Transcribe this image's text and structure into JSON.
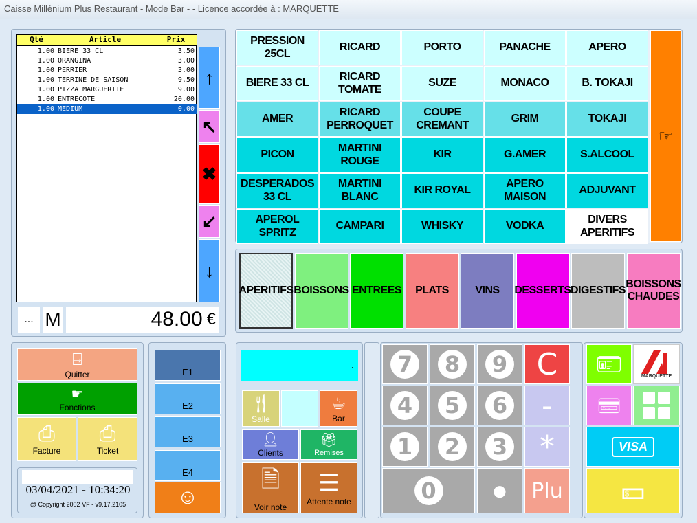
{
  "window": {
    "title": "Caisse Millénium Plus Restaurant - Mode Bar -   - Licence accordée à : MARQUETTE"
  },
  "ticket": {
    "headers": [
      "Qté",
      "Article",
      "Prix"
    ],
    "rows": [
      {
        "qty": "1.00",
        "article": "BIERE 33 CL",
        "price": "3.50"
      },
      {
        "qty": "1.00",
        "article": "ORANGINA",
        "price": "3.00"
      },
      {
        "qty": "1.00",
        "article": "PERRIER",
        "price": "3.00"
      },
      {
        "qty": "1.00",
        "article": "TERRINE DE SAISON",
        "price": "9.50"
      },
      {
        "qty": "1.00",
        "article": "PIZZA MARGUERITE",
        "price": "9.00"
      },
      {
        "qty": "1.00",
        "article": "ENTRECOTE",
        "price": "20.00"
      },
      {
        "qty": "1.00",
        "article": "MEDIUM",
        "price": "0.00"
      }
    ],
    "dots": "...",
    "mode": "M",
    "total": "48.00",
    "currency": "€"
  },
  "products": [
    "PRESSION 25CL",
    "RICARD",
    "PORTO",
    "PANACHE",
    "APERO",
    "BIERE 33 CL",
    "RICARD TOMATE",
    "SUZE",
    "MONACO",
    "B. TOKAJI",
    "AMER",
    "RICARD PERROQUET",
    "COUPE CREMANT",
    "GRIM",
    "TOKAJI",
    "PICON",
    "MARTINI ROUGE",
    "KIR",
    "G.AMER",
    "S.ALCOOL",
    "DESPERADOS 33 CL",
    "MARTINI BLANC",
    "KIR ROYAL",
    "APERO MAISON",
    "ADJUVANT",
    "APEROL SPRITZ",
    "CAMPARI",
    "WHISKY",
    "VODKA",
    "DIVERS APERITIFS"
  ],
  "categories": [
    {
      "label": "APERITIFS",
      "color": "#cfe4e4"
    },
    {
      "label": "BOISSONS",
      "color": "#7ff07f"
    },
    {
      "label": "ENTREES",
      "color": "#00e000"
    },
    {
      "label": "PLATS",
      "color": "#f78080"
    },
    {
      "label": "VINS",
      "color": "#7d7dc0"
    },
    {
      "label": "DESSERTS",
      "color": "#f000f0"
    },
    {
      "label": "DIGESTIFS",
      "color": "#bdbdbd"
    },
    {
      "label": "BOISSONS CHAUDES",
      "color": "#f77cc0"
    }
  ],
  "actions": {
    "quit": "Quitter",
    "functions": "Fonctions",
    "invoice": "Facture",
    "ticket": "Ticket"
  },
  "datetime": "03/04/2021 - 10:34:20",
  "copyright": "@ Copyright 2002 VF - v9.17.2105",
  "employees": [
    "E1",
    "E2",
    "E3",
    "E4"
  ],
  "display": {
    "value": "."
  },
  "service": {
    "room": "Salle",
    "bar": "Bar",
    "clients": "Clients",
    "discounts": "Remises",
    "view_note": "Voir note",
    "hold_note": "Attente note"
  },
  "keypad": {
    "keys": [
      "7",
      "8",
      "9",
      "C",
      "4",
      "5",
      "6",
      "-",
      "1",
      "2",
      "3",
      "*",
      "0",
      "●",
      "Plu"
    ]
  },
  "payment": {
    "brand": "MARQUETTE",
    "visa": "VISA"
  }
}
